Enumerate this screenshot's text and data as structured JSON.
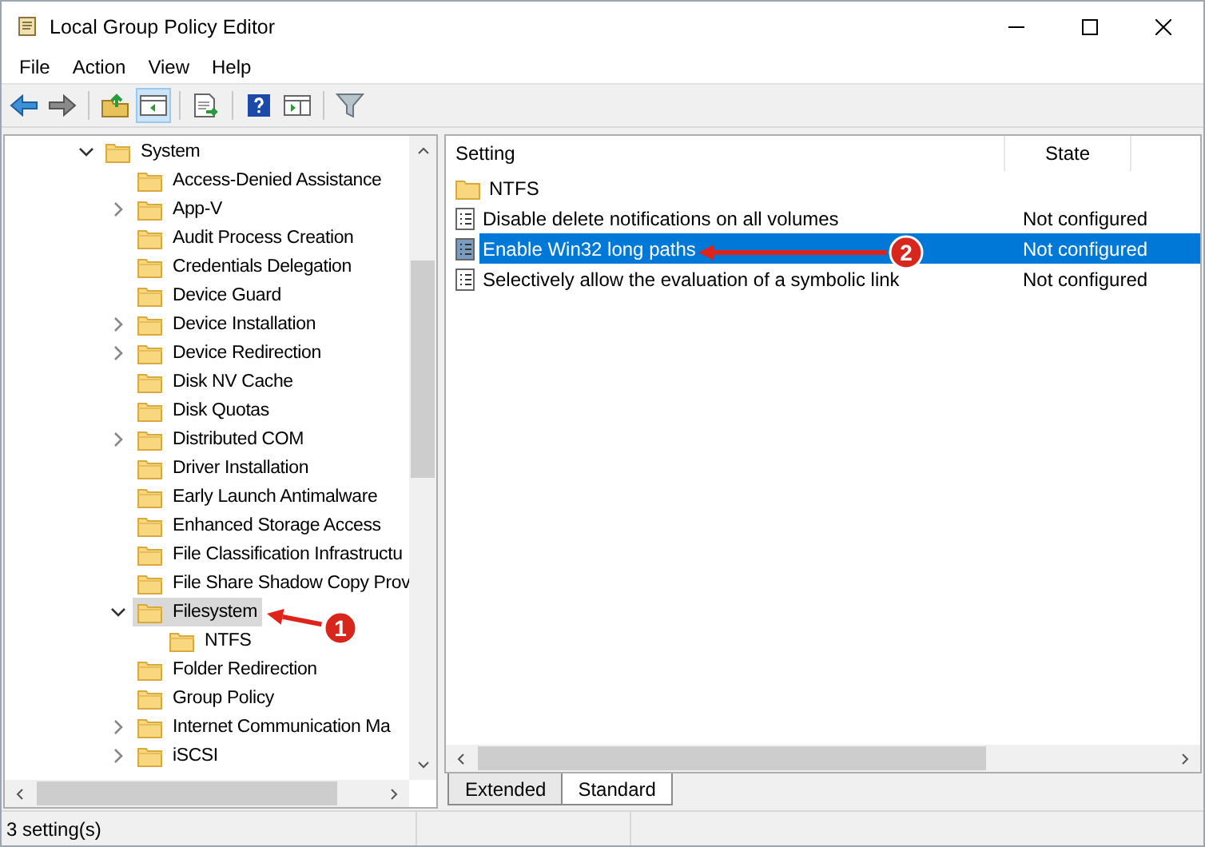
{
  "window": {
    "title": "Local Group Policy Editor"
  },
  "menu": [
    "File",
    "Action",
    "View",
    "Help"
  ],
  "toolbar": [
    {
      "kind": "back",
      "pressed": false
    },
    {
      "kind": "forward",
      "pressed": false
    },
    {
      "kind": "up",
      "pressed": false
    },
    {
      "kind": "tree",
      "pressed": true
    },
    {
      "kind": "export",
      "pressed": false
    },
    {
      "kind": "help",
      "pressed": false
    },
    {
      "kind": "pane",
      "pressed": false
    },
    {
      "kind": "filter",
      "pressed": false
    }
  ],
  "tree": [
    {
      "label": "System",
      "expanded": true,
      "selected": false,
      "children": [
        {
          "label": "Access-Denied Assistance",
          "selected": false
        },
        {
          "label": "App-V",
          "expanded": false,
          "selected": false
        },
        {
          "label": "Audit Process Creation",
          "selected": false
        },
        {
          "label": "Credentials Delegation",
          "selected": false
        },
        {
          "label": "Device Guard",
          "selected": false
        },
        {
          "label": "Device Installation",
          "expanded": false,
          "selected": false
        },
        {
          "label": "Device Redirection",
          "expanded": false,
          "selected": false
        },
        {
          "label": "Disk NV Cache",
          "selected": false
        },
        {
          "label": "Disk Quotas",
          "selected": false
        },
        {
          "label": "Distributed COM",
          "expanded": false,
          "selected": false
        },
        {
          "label": "Driver Installation",
          "selected": false
        },
        {
          "label": "Early Launch Antimalware",
          "selected": false
        },
        {
          "label": "Enhanced Storage Access",
          "selected": false
        },
        {
          "label": "File Classification Infrastructu",
          "selected": false
        },
        {
          "label": "File Share Shadow Copy Prov",
          "selected": false
        },
        {
          "label": "Filesystem",
          "expanded": true,
          "selected": true,
          "children": [
            {
              "label": "NTFS",
              "selected": false
            }
          ]
        },
        {
          "label": "Folder Redirection",
          "selected": false
        },
        {
          "label": "Group Policy",
          "selected": false
        },
        {
          "label": "Internet Communication Ma",
          "expanded": false,
          "selected": false
        },
        {
          "label": "iSCSI",
          "expanded": false,
          "selected": false
        }
      ]
    }
  ],
  "list": {
    "columns": [
      "Setting",
      "State"
    ],
    "rows": [
      {
        "kind": "folder",
        "name": "NTFS",
        "selected": false
      },
      {
        "kind": "setting",
        "name": "Disable delete notifications on all volumes",
        "state": "Not configured",
        "selected": false
      },
      {
        "kind": "setting",
        "name": "Enable Win32 long paths",
        "state": "Not configured",
        "selected": true
      },
      {
        "kind": "setting",
        "name": "Selectively allow the evaluation of a symbolic link",
        "state": "Not configured",
        "selected": false
      }
    ]
  },
  "tabs": [
    {
      "label": "Extended",
      "selected": false
    },
    {
      "label": "Standard",
      "selected": true
    }
  ],
  "status_bar": "3 setting(s)",
  "callouts": [
    {
      "label": "1"
    },
    {
      "label": "2"
    }
  ]
}
